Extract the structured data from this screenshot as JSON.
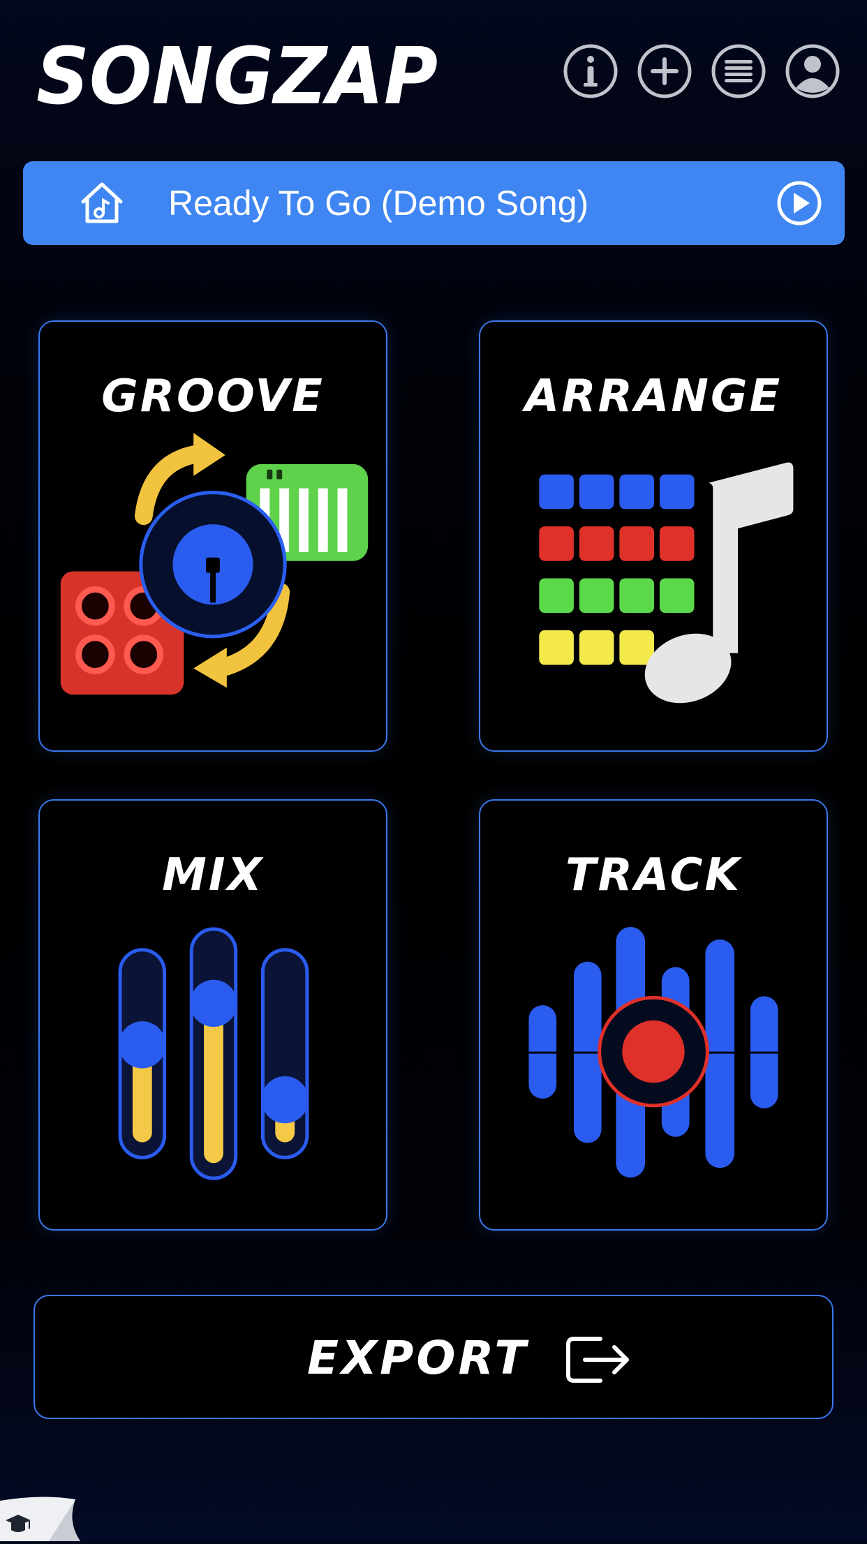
{
  "app": {
    "logo_text": "SONGZAP"
  },
  "header": {
    "icons": [
      {
        "name": "info-icon"
      },
      {
        "name": "add-icon"
      },
      {
        "name": "menu-icon"
      },
      {
        "name": "profile-icon"
      }
    ]
  },
  "song_bar": {
    "title": "Ready To Go (Demo Song)",
    "home_icon": "home-music-icon",
    "play_icon": "play-icon",
    "color": "#3f86f2"
  },
  "tiles": {
    "groove": "GROOVE",
    "arrange": "ARRANGE",
    "mix": "MIX",
    "track": "TRACK"
  },
  "mix_faders": [
    0.55,
    0.73,
    0.24
  ],
  "export": {
    "label": "EXPORT",
    "icon": "export-icon"
  },
  "colors": {
    "accent": "#3a78ee",
    "blue": "#2b5cf0",
    "red": "#e0302a",
    "green": "#5bd94a",
    "yellow": "#f3d94a"
  }
}
